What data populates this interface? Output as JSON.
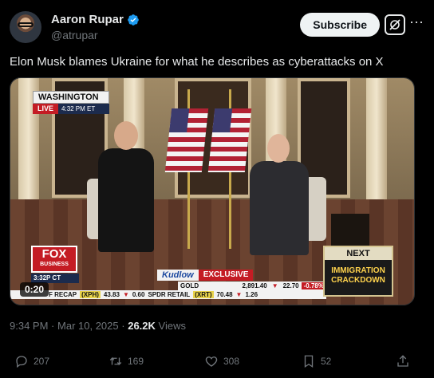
{
  "author": {
    "display_name": "Aaron Rupar",
    "handle": "@atrupar"
  },
  "header": {
    "subscribe_label": "Subscribe",
    "more_label": "···"
  },
  "tweet": {
    "text": "Elon Musk blames Ukraine for what he describes as cyberattacks on X"
  },
  "video": {
    "duration": "0:20",
    "location": "WASHINGTON",
    "live_label": "LIVE",
    "live_time": "4:32 PM ET",
    "network_name": "FOX",
    "network_sub": "BUSINESS",
    "network_time": "3:32P CT",
    "show_name": "Kudlow",
    "show_tag": "EXCLUSIVE",
    "next_label": "NEXT",
    "next_topic_line1": "IMMIGRATION",
    "next_topic_line2": "CRACKDOWN",
    "ticker_top": {
      "name": "GOLD",
      "price": "2,891.40",
      "change": "22.70",
      "pct": "-0.78%"
    },
    "ticker_bottom": {
      "lead": "F RECAP",
      "xph_label": "(XPH)",
      "xph_price": "43.83",
      "xph_change": "0.60",
      "spdr_label": "SPDR RETAIL",
      "spdr_sym": "(XRT)",
      "spdr_price": "70.48",
      "spdr_change": "1.26"
    }
  },
  "meta": {
    "time": "9:34 PM",
    "separator": "·",
    "date": "Mar 10, 2025",
    "views_count": "26.2K",
    "views_label": "Views"
  },
  "actions": {
    "replies": "207",
    "reposts": "169",
    "likes": "308",
    "bookmarks": "52"
  },
  "colors": {
    "background": "#000000",
    "text": "#e7e9ea",
    "muted": "#71767b",
    "verified": "#1d9bf0",
    "fox_red": "#c41c24"
  }
}
